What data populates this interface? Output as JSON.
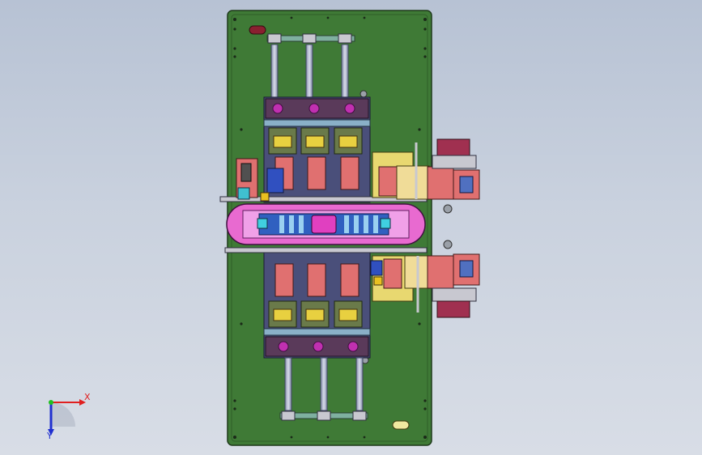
{
  "viewport": {
    "background_top": "#b7c2d4",
    "background_bottom": "#d8dde6"
  },
  "triad": {
    "x_label": "X",
    "y_label": "Y",
    "x_color": "#e02020",
    "y_color": "#20c020",
    "z_color": "#2030d0"
  },
  "colors": {
    "base_plate": "#3f7a36",
    "frame": "#4a4f7a",
    "pink": "#e86ad0",
    "magenta": "#c030b0",
    "salmon": "#e07070",
    "beige": "#f0dc98",
    "cyan": "#40d0e0",
    "shaft": "#a0a8c0"
  },
  "icons": {
    "axis_triad": "axis-triad-icon"
  }
}
